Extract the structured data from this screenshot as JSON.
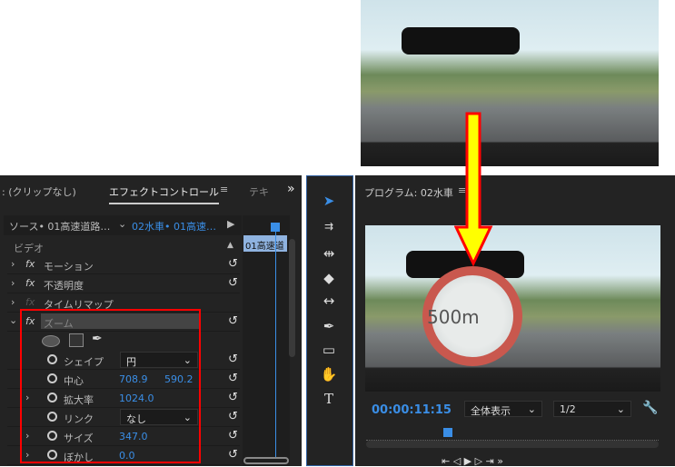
{
  "effect_controls": {
    "tabs": [
      ": (クリップなし)",
      "エフェクトコントロール",
      "テキ"
    ],
    "more": "»",
    "menu": "≡",
    "source_label": "ソース• 01高速道路…",
    "sequence_label": "02水車• 01高速…",
    "section": "ビデオ",
    "effects": [
      {
        "name": "モーション"
      },
      {
        "name": "不透明度"
      },
      {
        "name": "タイムリマップ"
      },
      {
        "name": "ズーム"
      }
    ],
    "zoom_params": [
      {
        "name": "シェイプ",
        "value": "円"
      },
      {
        "name": "中心",
        "value": "708.9",
        "value2": "590.2"
      },
      {
        "name": "拡大率",
        "value": "1024.0"
      },
      {
        "name": "リンク",
        "value": "なし"
      },
      {
        "name": "サイズ",
        "value": "347.0"
      },
      {
        "name": "ぼかし",
        "value": "0.0"
      }
    ],
    "clip_label": "01高速道"
  },
  "program": {
    "title": "プログラム: 02水車",
    "menu": "≡",
    "timecode": "00:00:11:15",
    "fit": "全体表示",
    "resolution": "1/2",
    "playhead_fraction": 0.28
  },
  "colors": {
    "accent": "#3a8ee6",
    "highlight": "#ff0000",
    "arrow": "#ffff00"
  }
}
